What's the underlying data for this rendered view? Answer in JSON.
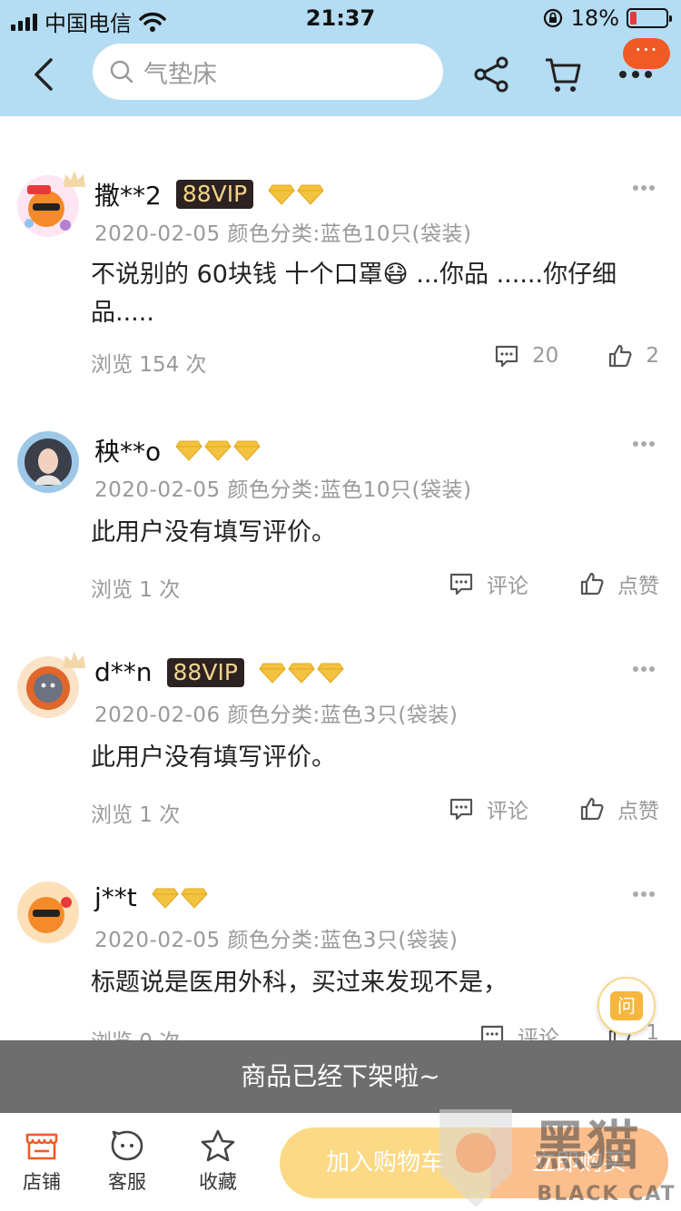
{
  "status": {
    "carrier": "中国电信",
    "time": "21:37",
    "battery": "18%",
    "battery_level": 0.18
  },
  "header": {
    "search_placeholder": "气垫床",
    "badge": "···"
  },
  "reviews": [
    {
      "user": "撒**2",
      "vip": "88VIP",
      "gems": 2,
      "date": "2020-02-05",
      "sku": "颜色分类:蓝色10只(袋装)",
      "text": "不说别的 60块钱 十个口罩😷 ...你品 ......你仔细品.....",
      "views": "浏览 154 次",
      "comments": "20",
      "likes": "2",
      "avatar_color": "#f58a2a"
    },
    {
      "user": "秧**o",
      "vip": "",
      "gems": 3,
      "date": "2020-02-05",
      "sku": "颜色分类:蓝色10只(袋装)",
      "text": "此用户没有填写评价。",
      "views": "浏览 1 次",
      "comments": "评论",
      "likes": "点赞",
      "avatar_color": "#5a6a80"
    },
    {
      "user": "d**n",
      "vip": "88VIP",
      "gems": 3,
      "date": "2020-02-06",
      "sku": "颜色分类:蓝色3只(袋装)",
      "text": "此用户没有填写评价。",
      "views": "浏览 1 次",
      "comments": "评论",
      "likes": "点赞",
      "avatar_color": "#e0662a"
    },
    {
      "user": "j**t",
      "vip": "",
      "gems": 2,
      "date": "2020-02-05",
      "sku": "颜色分类:蓝色3只(袋装)",
      "text": "标题说是医用外科，买过来发现不是，",
      "views": "浏览 0 次",
      "comments": "评论",
      "likes": "1",
      "avatar_color": "#f58a2a"
    }
  ],
  "ask_label": "问",
  "toast": "商品已经下架啦~",
  "bottom": {
    "tabs": [
      {
        "label": "店铺",
        "icon": "shop-icon"
      },
      {
        "label": "客服",
        "icon": "service-icon"
      },
      {
        "label": "收藏",
        "icon": "star-icon"
      }
    ],
    "add_cart": "加入购物车",
    "buy_now": "立即购买"
  },
  "watermark": {
    "text": "黑猫",
    "sub": "BLACK CAT"
  },
  "colors": {
    "header_bg": "#b4dcf2",
    "accent": "#f15a24",
    "cart_btn": "#fcd370",
    "buy_btn": "#fbb37a",
    "toast_bg": "#6e6e6e"
  }
}
